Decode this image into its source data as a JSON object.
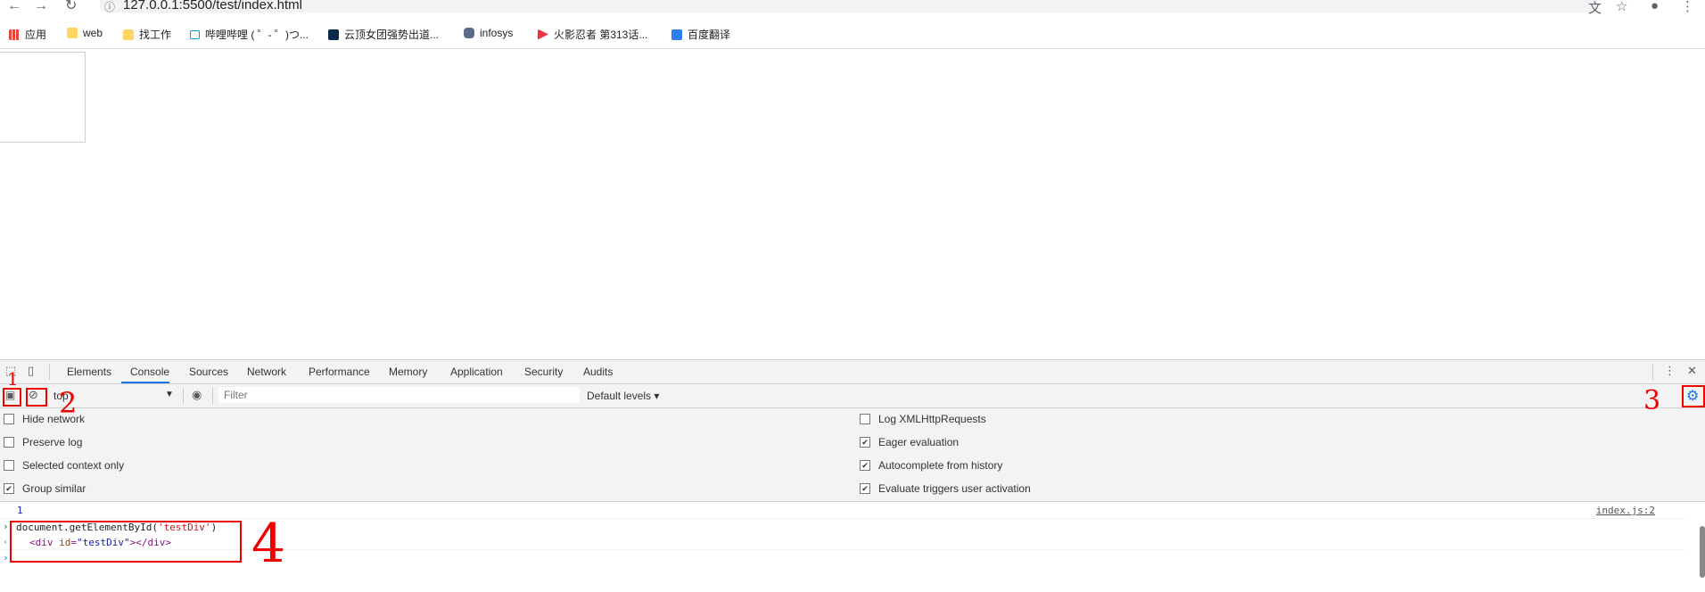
{
  "browser": {
    "url": "127.0.0.1:5500/test/index.html",
    "bookmarks": [
      "应用",
      "web",
      "找工作",
      "哔哩哔哩 ( ゜- ゜)つ...",
      "云顶女团强势出道...",
      "infosys",
      "火影忍者 第313话...",
      "百度翻译"
    ]
  },
  "devtools": {
    "tabs": [
      "Elements",
      "Console",
      "Sources",
      "Network",
      "Performance",
      "Memory",
      "Application",
      "Security",
      "Audits"
    ],
    "active_tab": "Console",
    "toolbar": {
      "context": "top",
      "filter_placeholder": "Filter",
      "levels": "Default levels ▾"
    },
    "settings": {
      "left": [
        {
          "label": "Hide network",
          "checked": false
        },
        {
          "label": "Preserve log",
          "checked": false
        },
        {
          "label": "Selected context only",
          "checked": false
        },
        {
          "label": "Group similar",
          "checked": true
        }
      ],
      "right": [
        {
          "label": "Log XMLHttpRequests",
          "checked": false
        },
        {
          "label": "Eager evaluation",
          "checked": true
        },
        {
          "label": "Autocomplete from history",
          "checked": true
        },
        {
          "label": "Evaluate triggers user activation",
          "checked": true
        }
      ]
    },
    "console": {
      "log_value": "1",
      "log_source": "index.js:2",
      "input_fn": "document.getElementById(",
      "input_arg": "'testDiv'",
      "input_close": ")",
      "result_open": "<div",
      "result_attr": "id",
      "result_val": "\"testDiv\"",
      "result_close": "></div>"
    }
  },
  "annotations": [
    "1",
    "2",
    "3",
    "4"
  ]
}
